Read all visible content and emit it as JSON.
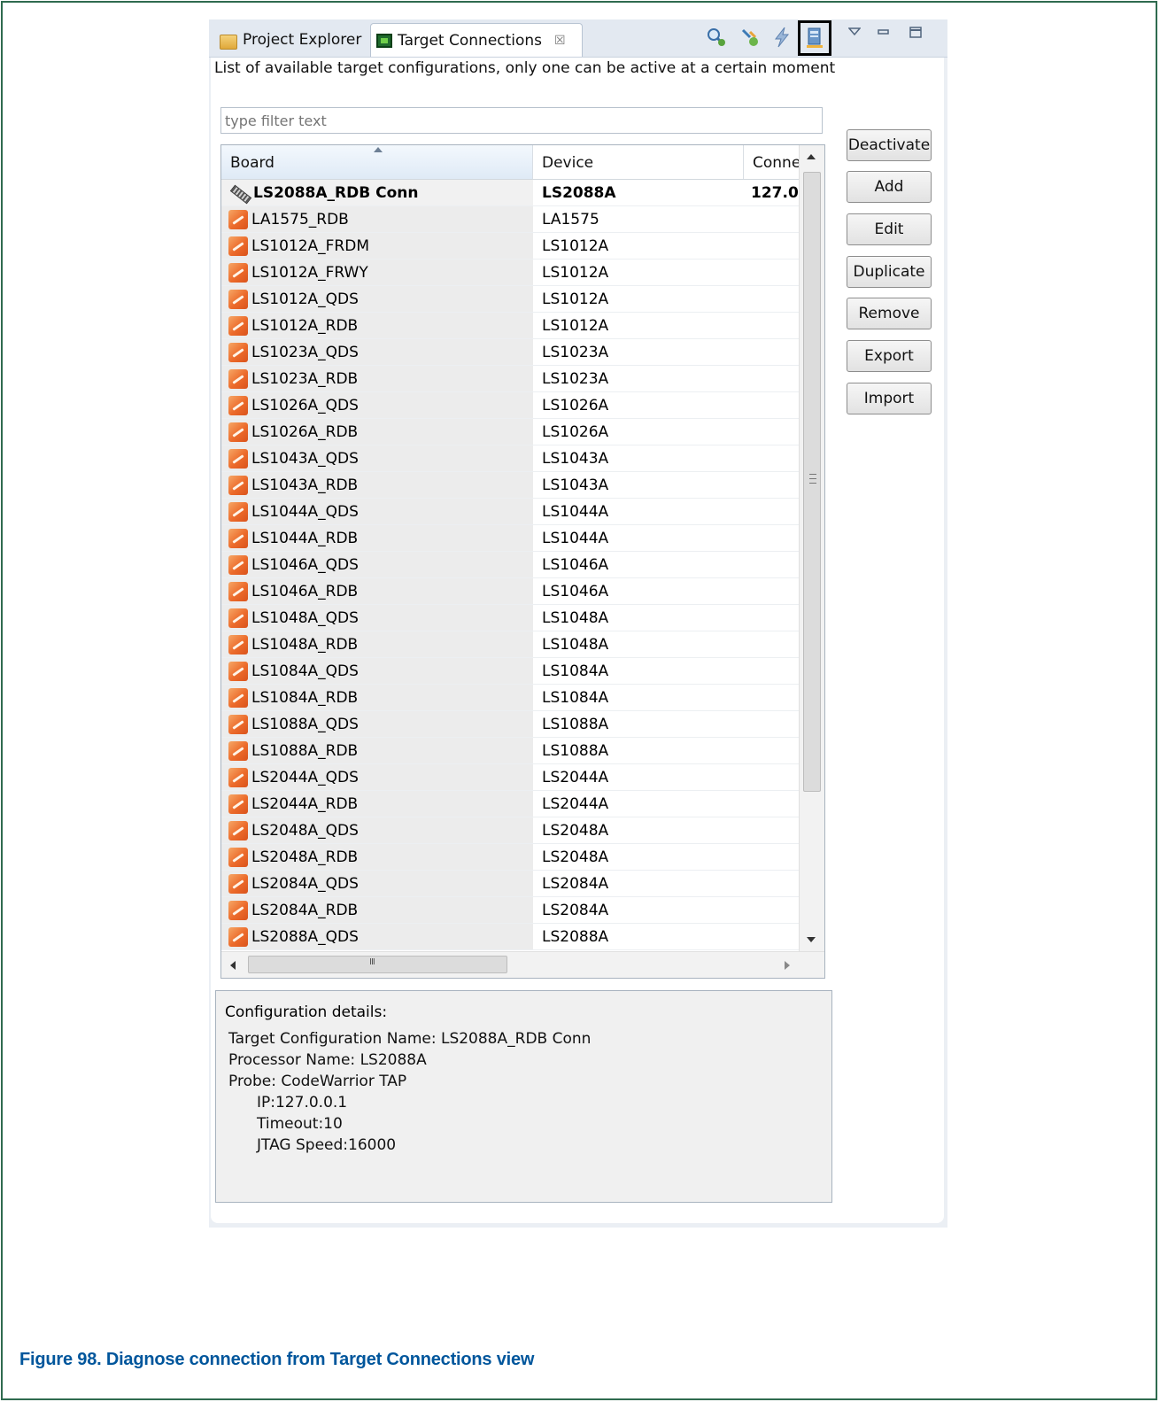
{
  "tabs": {
    "project_explorer": "Project Explorer",
    "target_connections": "Target Connections",
    "close_glyph": "☒"
  },
  "description": "List of available target configurations, only one can be active at a certain moment",
  "filter": {
    "placeholder": "type filter text",
    "value": ""
  },
  "table": {
    "columns": [
      "Board",
      "Device",
      "Conne"
    ],
    "rows": [
      {
        "board": "LS2088A_RDB Conn",
        "device": "LS2088A",
        "conn": "127.0",
        "active": true
      },
      {
        "board": "LA1575_RDB",
        "device": "LA1575",
        "conn": ""
      },
      {
        "board": "LS1012A_FRDM",
        "device": "LS1012A",
        "conn": ""
      },
      {
        "board": "LS1012A_FRWY",
        "device": "LS1012A",
        "conn": ""
      },
      {
        "board": "LS1012A_QDS",
        "device": "LS1012A",
        "conn": ""
      },
      {
        "board": "LS1012A_RDB",
        "device": "LS1012A",
        "conn": ""
      },
      {
        "board": "LS1023A_QDS",
        "device": "LS1023A",
        "conn": ""
      },
      {
        "board": "LS1023A_RDB",
        "device": "LS1023A",
        "conn": ""
      },
      {
        "board": "LS1026A_QDS",
        "device": "LS1026A",
        "conn": ""
      },
      {
        "board": "LS1026A_RDB",
        "device": "LS1026A",
        "conn": ""
      },
      {
        "board": "LS1043A_QDS",
        "device": "LS1043A",
        "conn": ""
      },
      {
        "board": "LS1043A_RDB",
        "device": "LS1043A",
        "conn": ""
      },
      {
        "board": "LS1044A_QDS",
        "device": "LS1044A",
        "conn": ""
      },
      {
        "board": "LS1044A_RDB",
        "device": "LS1044A",
        "conn": ""
      },
      {
        "board": "LS1046A_QDS",
        "device": "LS1046A",
        "conn": ""
      },
      {
        "board": "LS1046A_RDB",
        "device": "LS1046A",
        "conn": ""
      },
      {
        "board": "LS1048A_QDS",
        "device": "LS1048A",
        "conn": ""
      },
      {
        "board": "LS1048A_RDB",
        "device": "LS1048A",
        "conn": ""
      },
      {
        "board": "LS1084A_QDS",
        "device": "LS1084A",
        "conn": ""
      },
      {
        "board": "LS1084A_RDB",
        "device": "LS1084A",
        "conn": ""
      },
      {
        "board": "LS1088A_QDS",
        "device": "LS1088A",
        "conn": ""
      },
      {
        "board": "LS1088A_RDB",
        "device": "LS1088A",
        "conn": ""
      },
      {
        "board": "LS2044A_QDS",
        "device": "LS2044A",
        "conn": ""
      },
      {
        "board": "LS2044A_RDB",
        "device": "LS2044A",
        "conn": ""
      },
      {
        "board": "LS2048A_QDS",
        "device": "LS2048A",
        "conn": ""
      },
      {
        "board": "LS2048A_RDB",
        "device": "LS2048A",
        "conn": ""
      },
      {
        "board": "LS2084A_QDS",
        "device": "LS2084A",
        "conn": ""
      },
      {
        "board": "LS2084A_RDB",
        "device": "LS2084A",
        "conn": ""
      },
      {
        "board": "LS2088A_QDS",
        "device": "LS2088A",
        "conn": ""
      }
    ]
  },
  "buttons": {
    "deactivate": "Deactivate",
    "add": "Add",
    "edit": "Edit",
    "duplicate": "Duplicate",
    "remove": "Remove",
    "export": "Export",
    "import": "Import"
  },
  "details": {
    "title": "Configuration details:",
    "lines": [
      "Target Configuration Name: LS2088A_RDB Conn",
      "Processor Name: LS2088A",
      "Probe: CodeWarrior TAP",
      "IP:127.0.0.1",
      "Timeout:10",
      "JTAG Speed:16000"
    ]
  },
  "icons": {
    "toolbar": [
      "search-target-icon",
      "refresh-connection-icon",
      "lightning-icon",
      "diagnose-connection-icon"
    ],
    "window": [
      "view-menu-icon",
      "minimize-icon",
      "maximize-icon"
    ]
  },
  "caption": "Figure 98. Diagnose connection from Target Connections view",
  "colors": {
    "caption": "#00569c",
    "frame": "#2f6b4f",
    "board_icon": "#ec6a2a"
  }
}
